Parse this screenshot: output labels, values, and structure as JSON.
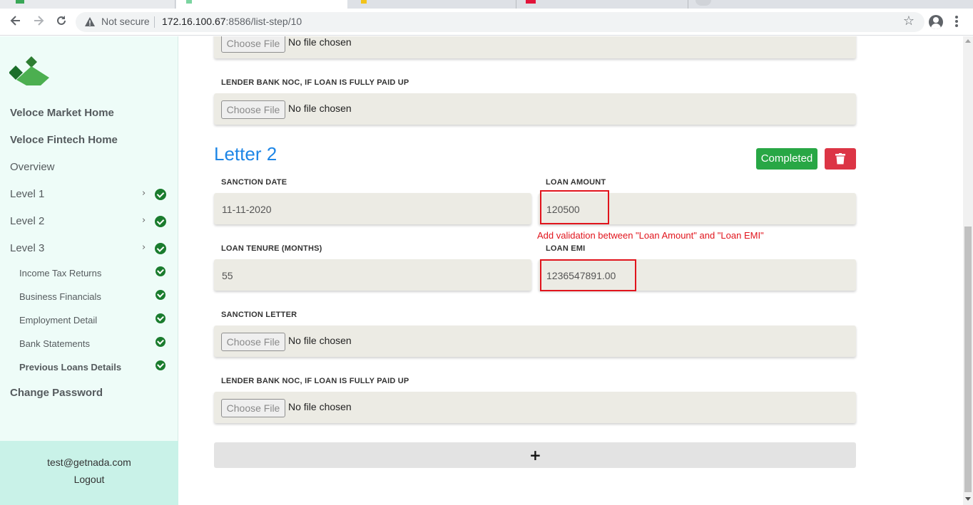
{
  "browser": {
    "security_label": "Not secure",
    "url_host": "172.16.100.67",
    "url_rest": ":8586/list-step/10",
    "back_icon": "back-arrow-icon",
    "forward_icon": "forward-arrow-icon",
    "reload_icon": "reload-icon"
  },
  "sidebar": {
    "links": [
      {
        "label": "Veloce Market Home"
      },
      {
        "label": "Veloce Fintech Home"
      },
      {
        "label": "Overview"
      }
    ],
    "levels": [
      {
        "label": "Level 1",
        "status": "completed"
      },
      {
        "label": "Level 2",
        "status": "completed"
      },
      {
        "label": "Level 3",
        "status": "completed"
      }
    ],
    "sub_items": [
      {
        "label": "Income Tax Returns",
        "status": "completed"
      },
      {
        "label": "Business Financials",
        "status": "completed"
      },
      {
        "label": "Employment Detail",
        "status": "completed"
      },
      {
        "label": "Bank Statements",
        "status": "completed"
      },
      {
        "label": "Previous Loans Details",
        "status": "completed"
      }
    ],
    "change_password": "Change Password",
    "user_email": "test@getnada.com",
    "logout": "Logout"
  },
  "form": {
    "file_button_label": "Choose File",
    "file_status": "No file chosen",
    "top_noc_label": "LENDER BANK NOC, IF LOAN IS FULLY PAID UP",
    "letter": {
      "title": "Letter 2",
      "status_button": "Completed",
      "sanction_date_label": "SANCTION DATE",
      "sanction_date_value": "11-11-2020",
      "loan_amount_label": "LOAN AMOUNT",
      "loan_amount_value": "120500",
      "loan_tenure_label": "LOAN TENURE (MONTHS)",
      "loan_tenure_value": "55",
      "loan_emi_label": "LOAN EMI",
      "loan_emi_value": "1236547891.00",
      "sanction_letter_label": "SANCTION LETTER",
      "noc_label": "LENDER BANK NOC, IF LOAN IS FULLY PAID UP"
    },
    "annotation": "Add validation between \"Loan Amount\" and \"Loan EMI\"",
    "add_button": "+"
  },
  "colors": {
    "accent_blue": "#1e86e6",
    "success_green": "#28a745",
    "danger_red": "#dc3545",
    "annotation_red": "#e1141c",
    "sidebar_bg": "#eefcf8"
  }
}
